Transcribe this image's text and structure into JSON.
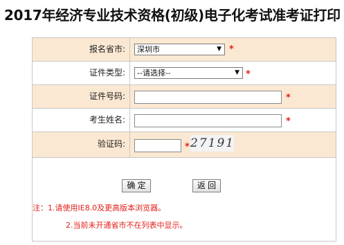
{
  "page": {
    "title": "2017年经济专业技术资格(初级)电子化考试准考证打印"
  },
  "form": {
    "province": {
      "label": "报名省市:",
      "selected": "深圳市",
      "required_mark": "*"
    },
    "id_type": {
      "label": "证件类型:",
      "selected": "--请选择--",
      "required_mark": "*"
    },
    "id_number": {
      "label": "证件号码:",
      "value": "",
      "required_mark": "*"
    },
    "name": {
      "label": "考生姓名:",
      "value": "",
      "required_mark": "*"
    },
    "captcha": {
      "label": "验证码:",
      "value": "",
      "required_mark": "*",
      "image_text": "27191"
    }
  },
  "buttons": {
    "confirm": "确 定",
    "back": "返 回"
  },
  "notes": {
    "line1": "注：1.请使用IE8.0及更高版本浏览器。",
    "line2": "2.当前未开通省市不在列表中显示。"
  },
  "colors": {
    "shaded_row": "#fbe8d2",
    "required": "#e0201b"
  }
}
